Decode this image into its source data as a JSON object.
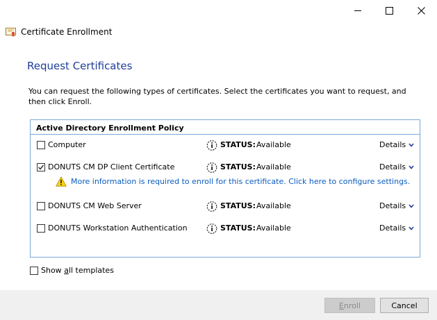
{
  "window": {
    "title": "Certificate Enrollment",
    "icon": "certificate-icon"
  },
  "page": {
    "title": "Request Certificates",
    "instructions": "You can request the following types of certificates. Select the certificates you want to request, and then click Enroll."
  },
  "policy": {
    "header": "Active Directory Enrollment Policy",
    "status_label": "STATUS:",
    "details_label": "Details",
    "certificates": [
      {
        "name": "Computer",
        "checked": false,
        "status": "Available"
      },
      {
        "name": "DONUTS CM DP Client Certificate",
        "checked": true,
        "status": "Available"
      },
      {
        "name": "DONUTS CM Web Server",
        "checked": false,
        "status": "Available"
      },
      {
        "name": "DONUTS Workstation Authentication",
        "checked": false,
        "status": "Available"
      }
    ],
    "warning": {
      "text": "More information is required to enroll for this certificate. Click here to configure settings.",
      "icon": "warning-icon"
    }
  },
  "options": {
    "show_all_templates_pre": "Show ",
    "show_all_templates_accel": "a",
    "show_all_templates_post": "ll templates",
    "show_all_checked": false
  },
  "buttons": {
    "enroll_accel": "E",
    "enroll_rest": "nroll",
    "cancel": "Cancel"
  },
  "colors": {
    "title_blue": "#1f3f9a",
    "link_blue": "#0b5cbf",
    "box_border": "#7aa6d9"
  }
}
